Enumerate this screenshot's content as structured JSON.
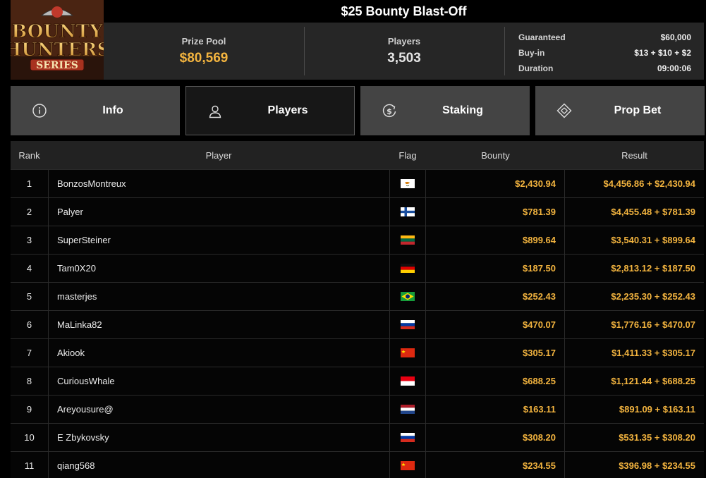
{
  "logo": {
    "line1": "BOUNTY",
    "line2": "HUNTERS",
    "line3": "SERIES"
  },
  "title": "$25 Bounty Blast-Off",
  "stats": {
    "prize_pool": {
      "label": "Prize Pool",
      "value": "$80,569"
    },
    "players": {
      "label": "Players",
      "value": "3,503"
    },
    "details": [
      {
        "label": "Guaranteed",
        "value": "$60,000"
      },
      {
        "label": "Buy-in",
        "value": "$13 + $10 + $2"
      },
      {
        "label": "Duration",
        "value": "09:00:06"
      }
    ]
  },
  "tabs": [
    {
      "label": "Info",
      "icon": "info-icon",
      "active": false
    },
    {
      "label": "Players",
      "icon": "user-icon",
      "active": true
    },
    {
      "label": "Staking",
      "icon": "dollar-cycle-icon",
      "active": false
    },
    {
      "label": "Prop Bet",
      "icon": "diamond-icon",
      "active": false
    }
  ],
  "colors": {
    "accent": "#f3b43f",
    "tab_bg": "#444444",
    "tab_active_bg": "#171717"
  },
  "table": {
    "headers": {
      "rank": "Rank",
      "player": "Player",
      "flag": "Flag",
      "bounty": "Bounty",
      "result": "Result"
    },
    "rows": [
      {
        "rank": "1",
        "player": "BonzosMontreux",
        "flag": "cyprus",
        "bounty": "$2,430.94",
        "result": "$4,456.86 + $2,430.94"
      },
      {
        "rank": "2",
        "player": "Palyer",
        "flag": "finland",
        "bounty": "$781.39",
        "result": "$4,455.48 + $781.39"
      },
      {
        "rank": "3",
        "player": "SuperSteiner",
        "flag": "lithuania",
        "bounty": "$899.64",
        "result": "$3,540.31 + $899.64"
      },
      {
        "rank": "4",
        "player": "Tam0X20",
        "flag": "germany",
        "bounty": "$187.50",
        "result": "$2,813.12 + $187.50"
      },
      {
        "rank": "5",
        "player": "masterjes",
        "flag": "brazil",
        "bounty": "$252.43",
        "result": "$2,235.30 + $252.43"
      },
      {
        "rank": "6",
        "player": "MaLinka82",
        "flag": "russia",
        "bounty": "$470.07",
        "result": "$1,776.16 + $470.07"
      },
      {
        "rank": "7",
        "player": "Akiook",
        "flag": "china",
        "bounty": "$305.17",
        "result": "$1,411.33 + $305.17"
      },
      {
        "rank": "8",
        "player": "CuriousWhale",
        "flag": "indonesia",
        "bounty": "$688.25",
        "result": "$1,121.44 + $688.25"
      },
      {
        "rank": "9",
        "player": "Areyousure@",
        "flag": "netherlands",
        "bounty": "$163.11",
        "result": "$891.09 + $163.11"
      },
      {
        "rank": "10",
        "player": "E Zbykovsky",
        "flag": "russia",
        "bounty": "$308.20",
        "result": "$531.35 + $308.20"
      },
      {
        "rank": "11",
        "player": "qiang568",
        "flag": "china",
        "bounty": "$234.55",
        "result": "$396.98 + $234.55"
      }
    ]
  }
}
